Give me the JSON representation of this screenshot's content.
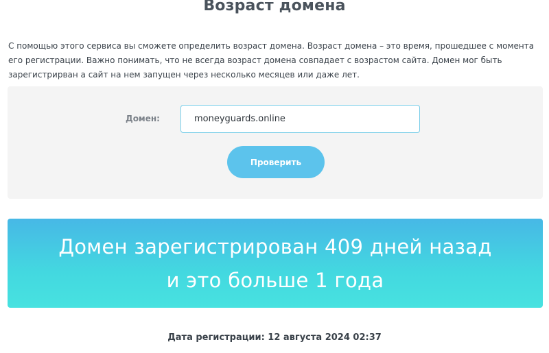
{
  "page": {
    "title": "Возраст домена",
    "description": "С помощью этого сервиса вы сможете определить возраст домена. Возраст домена – это время, прошедшее с момента его регистрации. Важно понимать, что не всегда возраст домена совпадает с возрастом сайта. Домен мог быть зарегистрирван а сайт на нем запущен через несколько месяцев или даже лет."
  },
  "form": {
    "domain_label": "Домен:",
    "domain_value": "moneyguards.online",
    "check_button_label": "Проверить"
  },
  "result": {
    "line1": "Домен зарегистрирован 409 дней назад",
    "line2": "и это больше 1 года",
    "registration_date": "Дата регистрации: 12 августа 2024 02:37"
  },
  "colors": {
    "accent": "#5cc3ec",
    "banner_top": "#47b8e6",
    "banner_bottom": "#47e2e0",
    "panel_bg": "#f4f4f4"
  }
}
